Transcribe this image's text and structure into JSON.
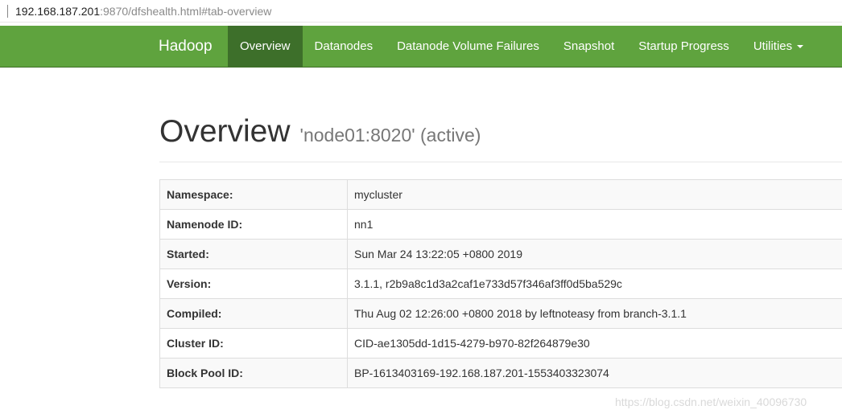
{
  "address_bar": {
    "host": "192.168.187.201",
    "rest": ":9870/dfshealth.html#tab-overview"
  },
  "navbar": {
    "brand": "Hadoop",
    "items": [
      {
        "label": "Overview",
        "active": true
      },
      {
        "label": "Datanodes"
      },
      {
        "label": "Datanode Volume Failures"
      },
      {
        "label": "Snapshot"
      },
      {
        "label": "Startup Progress"
      },
      {
        "label": "Utilities"
      }
    ]
  },
  "header": {
    "title": "Overview",
    "subtitle": "'node01:8020' (active)"
  },
  "info_table": [
    {
      "key": "Namespace:",
      "value": "mycluster"
    },
    {
      "key": "Namenode ID:",
      "value": "nn1"
    },
    {
      "key": "Started:",
      "value": "Sun Mar 24 13:22:05 +0800 2019"
    },
    {
      "key": "Version:",
      "value": "3.1.1, r2b9a8c1d3a2caf1e733d57f346af3ff0d5ba529c"
    },
    {
      "key": "Compiled:",
      "value": "Thu Aug 02 12:26:00 +0800 2018 by leftnoteasy from branch-3.1.1"
    },
    {
      "key": "Cluster ID:",
      "value": "CID-ae1305dd-1d15-4279-b970-82f264879e30"
    },
    {
      "key": "Block Pool ID:",
      "value": "BP-1613403169-192.168.187.201-1553403323074"
    }
  ],
  "watermark": "https://blog.csdn.net/weixin_40096730",
  "colors": {
    "navbar": "#5fa33e",
    "navbar_active": "#3d6f2a"
  }
}
